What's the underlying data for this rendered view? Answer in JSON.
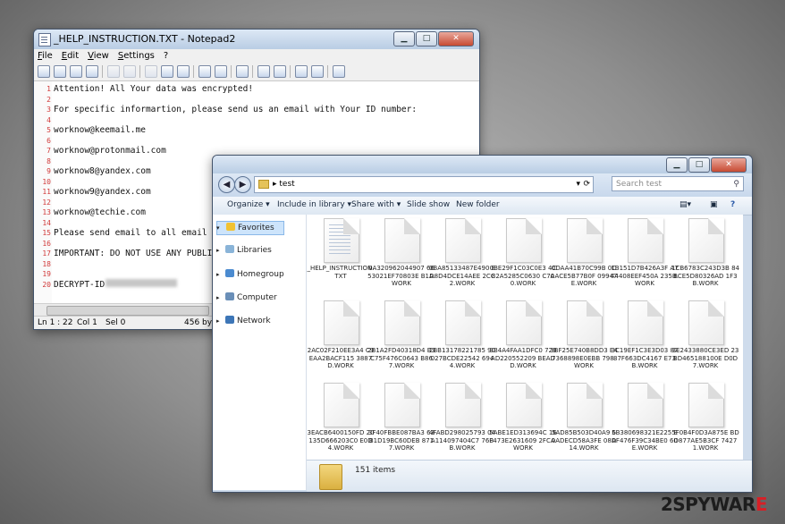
{
  "notepad": {
    "title": "_HELP_INSTRUCTION.TXT - Notepad2",
    "menu": [
      "File",
      "Edit",
      "View",
      "Settings",
      "?"
    ],
    "lines": [
      {
        "n": "1",
        "t": "Attention! All Your data was encrypted!"
      },
      {
        "n": "2",
        "t": ""
      },
      {
        "n": "3",
        "t": "For specific informartion, please send us an email with Your ID number:"
      },
      {
        "n": "4",
        "t": ""
      },
      {
        "n": "5",
        "t": "worknow@keemail.me"
      },
      {
        "n": "6",
        "t": ""
      },
      {
        "n": "7",
        "t": "worknow@protonmail.com"
      },
      {
        "n": "8",
        "t": ""
      },
      {
        "n": "9",
        "t": "worknow8@yandex.com"
      },
      {
        "n": "10",
        "t": ""
      },
      {
        "n": "11",
        "t": "worknow9@yandex.com"
      },
      {
        "n": "12",
        "t": ""
      },
      {
        "n": "13",
        "t": "worknow@techie.com"
      },
      {
        "n": "14",
        "t": ""
      },
      {
        "n": "15",
        "t": "Please send email to all email ad"
      },
      {
        "n": "16",
        "t": ""
      },
      {
        "n": "17",
        "t": "IMPORTANT: DO NOT USE ANY PUBLIC "
      },
      {
        "n": "18",
        "t": ""
      },
      {
        "n": "19",
        "t": ""
      },
      {
        "n": "20",
        "t": "DECRYPT-ID"
      }
    ],
    "status": {
      "position": "Ln 1 : 22",
      "col": "Col 1",
      "sel": "Sel 0",
      "size": "456 byte"
    }
  },
  "explorer": {
    "address": "test",
    "search_placeholder": "Search test",
    "commands": [
      "Organize ▾",
      "Include in library ▾",
      "Share with ▾",
      "Slide show",
      "New folder"
    ],
    "nav": [
      "Favorites",
      "Libraries",
      "Homegroup",
      "Computer",
      "Network"
    ],
    "files": [
      "_HELP_INSTRUCTION.TXT",
      "0A320962044907 6653021EF70803E B1A.WORK",
      "0BA85133487E490 ED8D4DCE14AEE 2CC2.WORK",
      "0BE29F1C03C0E3 4C82A5285C0630 C700.WORK",
      "0DAA41B70C99B 0CAACE5B77B0F 09947E.WORK",
      "1B151D7B426A3F A744408EEF450A 235B.WORK",
      "1CB6783C243D3B 848CE5D80326AD 1F3B.WORK",
      "2AC02F210EE3A4 C9EAA2BACF115 3887D.WORK",
      "2B1A2FD40318D4 B3C75F476C0643 B867.WORK",
      "2BB13178221785 90027BCDE22542 6944.WORK",
      "3B4A4FAA1DFC0 729AD220552209 BEADD.WORK",
      "3BF25E740B8DD3 E47368898E0EBB 798.WORK",
      "3C19EF1C3E3D03 8787F663DC4167 E73B.WORK",
      "3E2433880CE3ED 23BD465188100E D0D7.WORK",
      "3EACB6400150FD 20135D666203C0 E0D4.WORK",
      "3F40FBBE087BA3 63B1D19BC60DEB 8717.WORK",
      "4FABD298025793 04A114097404C7 76BB.WORK",
      "5ABE1ED313694C 16F473E2631609 2FCA.WORK",
      "5AD85B503D40A9 60ADECD58A3FE 08D14.WORK",
      "5B380698321E225 EAF476F39C34BE0 60E.WORK",
      "5F0B4F0D3A875E BDD877AE5B3CF 74271.WORK"
    ],
    "item_count": "151 items"
  },
  "watermark": {
    "prefix": "2SPYWAR",
    "suffix": "E"
  }
}
